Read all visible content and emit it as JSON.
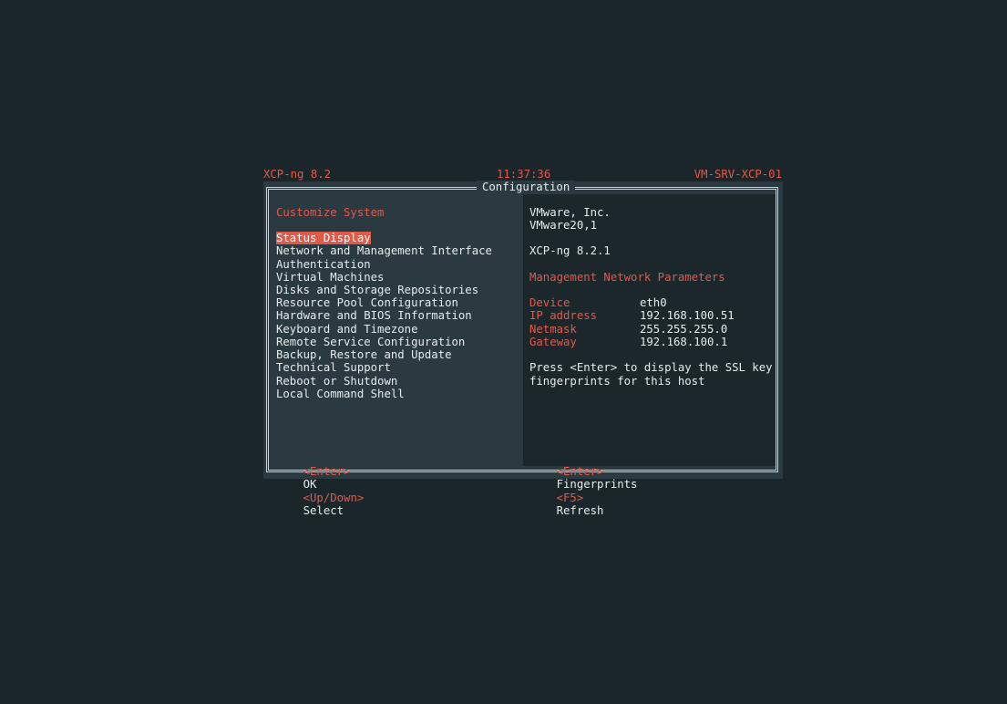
{
  "header": {
    "product": "XCP-ng 8.2",
    "time": "11:37:36",
    "hostname": "VM-SRV-XCP-01"
  },
  "window": {
    "title": "Configuration"
  },
  "menu": {
    "title": "Customize System",
    "selected_index": 0,
    "items": [
      "Status Display",
      "Network and Management Interface",
      "Authentication",
      "Virtual Machines",
      "Disks and Storage Repositories",
      "Resource Pool Configuration",
      "Hardware and BIOS Information",
      "Keyboard and Timezone",
      "Remote Service Configuration",
      "Backup, Restore and Update",
      "Technical Support",
      "Reboot or Shutdown",
      "Local Command Shell"
    ]
  },
  "info": {
    "vendor": "VMware, Inc.",
    "model": "VMware20,1",
    "version": "XCP-ng 8.2.1",
    "section_title": "Management Network Parameters",
    "params": [
      {
        "key": "Device",
        "value": "eth0"
      },
      {
        "key": "IP address",
        "value": "192.168.100.51"
      },
      {
        "key": "Netmask",
        "value": "255.255.255.0"
      },
      {
        "key": "Gateway",
        "value": "192.168.100.1"
      }
    ],
    "message_line1": "Press <Enter> to display the SSL key",
    "message_line2": "fingerprints for this host"
  },
  "footer": {
    "left": [
      {
        "key": "<Enter>",
        "label": "OK"
      },
      {
        "key": "<Up/Down>",
        "label": "Select"
      }
    ],
    "right": [
      {
        "key": "<Enter>",
        "label": "Fingerprints"
      },
      {
        "key": "<F5>",
        "label": "Refresh"
      }
    ]
  },
  "colors": {
    "background": "#1b262b",
    "panel": "#2b3a40",
    "accent": "#e05a4a",
    "text": "#e6ecee"
  }
}
